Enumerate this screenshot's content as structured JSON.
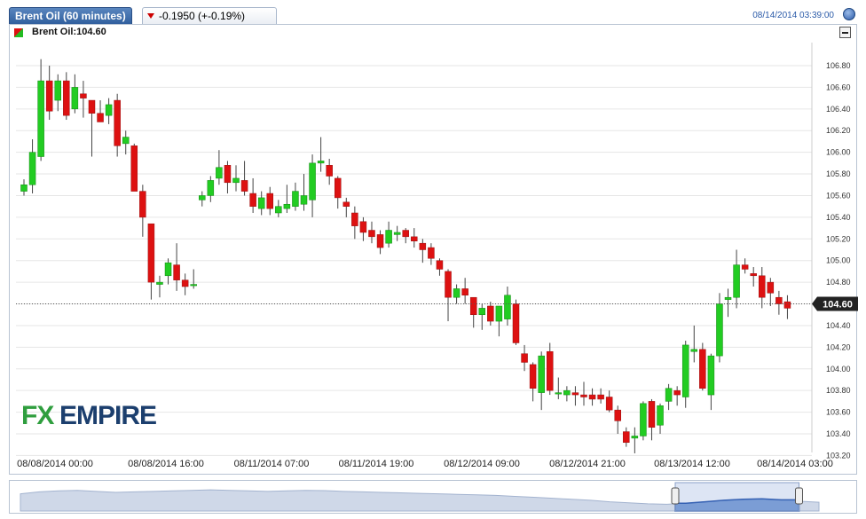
{
  "header": {
    "title": "Brent Oil (60 minutes)",
    "change": "-0.1950 (+-0.19%)",
    "timestamp": "08/14/2014 03:39:00",
    "help_icon": "help-circle-icon",
    "change_arrow_icon": "down-triangle-icon",
    "colors": {
      "tab": "#2e5d9c",
      "down": "#cc0000",
      "up": "#22bb22",
      "timestamp": "#2a5aa8"
    }
  },
  "legend": {
    "label": "Brent Oil:104.60"
  },
  "watermark": {
    "fx": "FX",
    "empire": "EMPIRE"
  },
  "chart_data": {
    "type": "candlestick",
    "ylim": [
      103.2,
      106.9
    ],
    "y_ticks": [
      "106.80",
      "106.60",
      "106.40",
      "106.20",
      "106.00",
      "105.80",
      "105.60",
      "105.40",
      "105.20",
      "105.00",
      "104.80",
      "104.60",
      "104.40",
      "104.20",
      "104.00",
      "103.80",
      "103.60",
      "103.40",
      "103.20"
    ],
    "x_tick_labels": [
      "08/08/2014 00:00",
      "08/08/2014 16:00",
      "08/11/2014 07:00",
      "08/11/2014 19:00",
      "08/12/2014 09:00",
      "08/12/2014 21:00",
      "08/13/2014 12:00",
      "08/14/2014 03:00"
    ],
    "last_price": "104.60",
    "last_price_value": 104.6,
    "candles": [
      {
        "o": 105.64,
        "h": 105.75,
        "l": 105.6,
        "c": 105.7
      },
      {
        "o": 105.7,
        "h": 106.12,
        "l": 105.62,
        "c": 106.0
      },
      {
        "o": 105.96,
        "h": 106.86,
        "l": 105.92,
        "c": 106.66
      },
      {
        "o": 106.66,
        "h": 106.8,
        "l": 106.3,
        "c": 106.38
      },
      {
        "o": 106.48,
        "h": 106.72,
        "l": 106.38,
        "c": 106.66
      },
      {
        "o": 106.66,
        "h": 106.74,
        "l": 106.3,
        "c": 106.34
      },
      {
        "o": 106.4,
        "h": 106.72,
        "l": 106.36,
        "c": 106.6
      },
      {
        "o": 106.54,
        "h": 106.66,
        "l": 106.32,
        "c": 106.5
      },
      {
        "o": 106.48,
        "h": 106.48,
        "l": 105.96,
        "c": 106.36
      },
      {
        "o": 106.36,
        "h": 106.48,
        "l": 106.28,
        "c": 106.28
      },
      {
        "o": 106.34,
        "h": 106.5,
        "l": 106.26,
        "c": 106.44
      },
      {
        "o": 106.48,
        "h": 106.54,
        "l": 105.96,
        "c": 106.06
      },
      {
        "o": 106.08,
        "h": 106.2,
        "l": 105.98,
        "c": 106.14
      },
      {
        "o": 106.06,
        "h": 106.08,
        "l": 105.66,
        "c": 105.64
      },
      {
        "o": 105.64,
        "h": 105.7,
        "l": 105.22,
        "c": 105.4
      },
      {
        "o": 105.34,
        "h": 105.34,
        "l": 104.64,
        "c": 104.8
      },
      {
        "o": 104.78,
        "h": 104.86,
        "l": 104.66,
        "c": 104.8
      },
      {
        "o": 104.86,
        "h": 105.02,
        "l": 104.78,
        "c": 104.98
      },
      {
        "o": 104.96,
        "h": 105.16,
        "l": 104.72,
        "c": 104.82
      },
      {
        "o": 104.82,
        "h": 104.88,
        "l": 104.68,
        "c": 104.76
      },
      {
        "o": 104.78,
        "h": 104.92,
        "l": 104.74,
        "c": 104.78
      },
      {
        "o": 105.56,
        "h": 105.64,
        "l": 105.5,
        "c": 105.6
      },
      {
        "o": 105.6,
        "h": 105.78,
        "l": 105.54,
        "c": 105.74
      },
      {
        "o": 105.76,
        "h": 106.02,
        "l": 105.7,
        "c": 105.86
      },
      {
        "o": 105.88,
        "h": 105.92,
        "l": 105.62,
        "c": 105.72
      },
      {
        "o": 105.72,
        "h": 105.88,
        "l": 105.64,
        "c": 105.76
      },
      {
        "o": 105.74,
        "h": 105.92,
        "l": 105.6,
        "c": 105.64
      },
      {
        "o": 105.62,
        "h": 105.76,
        "l": 105.44,
        "c": 105.5
      },
      {
        "o": 105.48,
        "h": 105.64,
        "l": 105.42,
        "c": 105.58
      },
      {
        "o": 105.62,
        "h": 105.68,
        "l": 105.42,
        "c": 105.48
      },
      {
        "o": 105.44,
        "h": 105.56,
        "l": 105.4,
        "c": 105.5
      },
      {
        "o": 105.48,
        "h": 105.7,
        "l": 105.44,
        "c": 105.52
      },
      {
        "o": 105.5,
        "h": 105.72,
        "l": 105.46,
        "c": 105.64
      },
      {
        "o": 105.52,
        "h": 105.8,
        "l": 105.46,
        "c": 105.6
      },
      {
        "o": 105.56,
        "h": 105.98,
        "l": 105.4,
        "c": 105.9
      },
      {
        "o": 105.9,
        "h": 106.14,
        "l": 105.82,
        "c": 105.92
      },
      {
        "o": 105.88,
        "h": 105.94,
        "l": 105.7,
        "c": 105.78
      },
      {
        "o": 105.76,
        "h": 105.78,
        "l": 105.48,
        "c": 105.58
      },
      {
        "o": 105.54,
        "h": 105.58,
        "l": 105.4,
        "c": 105.5
      },
      {
        "o": 105.44,
        "h": 105.5,
        "l": 105.2,
        "c": 105.32
      },
      {
        "o": 105.36,
        "h": 105.4,
        "l": 105.18,
        "c": 105.26
      },
      {
        "o": 105.28,
        "h": 105.36,
        "l": 105.16,
        "c": 105.22
      },
      {
        "o": 105.24,
        "h": 105.28,
        "l": 105.06,
        "c": 105.12
      },
      {
        "o": 105.16,
        "h": 105.36,
        "l": 105.12,
        "c": 105.28
      },
      {
        "o": 105.24,
        "h": 105.32,
        "l": 105.18,
        "c": 105.26
      },
      {
        "o": 105.28,
        "h": 105.3,
        "l": 105.16,
        "c": 105.22
      },
      {
        "o": 105.22,
        "h": 105.3,
        "l": 105.12,
        "c": 105.18
      },
      {
        "o": 105.16,
        "h": 105.2,
        "l": 104.98,
        "c": 105.1
      },
      {
        "o": 105.12,
        "h": 105.16,
        "l": 104.96,
        "c": 105.02
      },
      {
        "o": 105.0,
        "h": 105.02,
        "l": 104.86,
        "c": 104.92
      },
      {
        "o": 104.9,
        "h": 104.92,
        "l": 104.44,
        "c": 104.66
      },
      {
        "o": 104.66,
        "h": 104.78,
        "l": 104.6,
        "c": 104.74
      },
      {
        "o": 104.74,
        "h": 104.84,
        "l": 104.6,
        "c": 104.68
      },
      {
        "o": 104.66,
        "h": 104.66,
        "l": 104.38,
        "c": 104.5
      },
      {
        "o": 104.5,
        "h": 104.6,
        "l": 104.36,
        "c": 104.56
      },
      {
        "o": 104.58,
        "h": 104.62,
        "l": 104.4,
        "c": 104.44
      },
      {
        "o": 104.44,
        "h": 104.56,
        "l": 104.3,
        "c": 104.58
      },
      {
        "o": 104.46,
        "h": 104.76,
        "l": 104.4,
        "c": 104.68
      },
      {
        "o": 104.6,
        "h": 104.64,
        "l": 104.22,
        "c": 104.24
      },
      {
        "o": 104.14,
        "h": 104.22,
        "l": 103.98,
        "c": 104.06
      },
      {
        "o": 104.04,
        "h": 104.06,
        "l": 103.7,
        "c": 103.82
      },
      {
        "o": 103.78,
        "h": 104.16,
        "l": 103.62,
        "c": 104.12
      },
      {
        "o": 104.16,
        "h": 104.24,
        "l": 103.76,
        "c": 103.8
      },
      {
        "o": 103.78,
        "h": 103.92,
        "l": 103.72,
        "c": 103.78
      },
      {
        "o": 103.76,
        "h": 103.84,
        "l": 103.7,
        "c": 103.8
      },
      {
        "o": 103.78,
        "h": 103.84,
        "l": 103.66,
        "c": 103.76
      },
      {
        "o": 103.76,
        "h": 103.88,
        "l": 103.66,
        "c": 103.74
      },
      {
        "o": 103.76,
        "h": 103.82,
        "l": 103.66,
        "c": 103.72
      },
      {
        "o": 103.76,
        "h": 103.82,
        "l": 103.68,
        "c": 103.72
      },
      {
        "o": 103.74,
        "h": 103.8,
        "l": 103.6,
        "c": 103.62
      },
      {
        "o": 103.62,
        "h": 103.66,
        "l": 103.4,
        "c": 103.52
      },
      {
        "o": 103.42,
        "h": 103.46,
        "l": 103.28,
        "c": 103.32
      },
      {
        "o": 103.36,
        "h": 103.46,
        "l": 103.22,
        "c": 103.38
      },
      {
        "o": 103.38,
        "h": 103.7,
        "l": 103.34,
        "c": 103.68
      },
      {
        "o": 103.7,
        "h": 103.72,
        "l": 103.34,
        "c": 103.46
      },
      {
        "o": 103.48,
        "h": 103.68,
        "l": 103.4,
        "c": 103.66
      },
      {
        "o": 103.7,
        "h": 103.86,
        "l": 103.62,
        "c": 103.82
      },
      {
        "o": 103.8,
        "h": 103.84,
        "l": 103.66,
        "c": 103.76
      },
      {
        "o": 103.74,
        "h": 104.26,
        "l": 103.64,
        "c": 104.22
      },
      {
        "o": 104.16,
        "h": 104.4,
        "l": 104.06,
        "c": 104.18
      },
      {
        "o": 104.18,
        "h": 104.24,
        "l": 103.8,
        "c": 103.82
      },
      {
        "o": 103.76,
        "h": 104.14,
        "l": 103.62,
        "c": 104.12
      },
      {
        "o": 104.12,
        "h": 104.7,
        "l": 104.06,
        "c": 104.6
      },
      {
        "o": 104.64,
        "h": 104.74,
        "l": 104.48,
        "c": 104.66
      },
      {
        "o": 104.66,
        "h": 105.1,
        "l": 104.56,
        "c": 104.96
      },
      {
        "o": 104.96,
        "h": 105.02,
        "l": 104.88,
        "c": 104.92
      },
      {
        "o": 104.88,
        "h": 104.94,
        "l": 104.76,
        "c": 104.86
      },
      {
        "o": 104.86,
        "h": 104.94,
        "l": 104.56,
        "c": 104.66
      },
      {
        "o": 104.8,
        "h": 104.84,
        "l": 104.58,
        "c": 104.7
      },
      {
        "o": 104.66,
        "h": 104.72,
        "l": 104.5,
        "c": 104.6
      },
      {
        "o": 104.62,
        "h": 104.68,
        "l": 104.46,
        "c": 104.56
      }
    ],
    "gaps_after_index": [
      20
    ],
    "navigator": {
      "series": [
        0.62,
        0.7,
        0.74,
        0.76,
        0.72,
        0.68,
        0.7,
        0.72,
        0.74,
        0.76,
        0.78,
        0.76,
        0.74,
        0.72,
        0.74,
        0.76,
        0.75,
        0.72,
        0.7,
        0.68,
        0.66,
        0.64,
        0.62,
        0.6,
        0.58,
        0.56,
        0.52,
        0.48,
        0.44,
        0.4,
        0.36,
        0.3,
        0.26,
        0.22,
        0.2,
        0.24,
        0.3,
        0.36,
        0.4,
        0.42,
        0.38,
        0.32,
        0.28
      ],
      "window_start": 0.82,
      "window_end": 0.975
    }
  }
}
